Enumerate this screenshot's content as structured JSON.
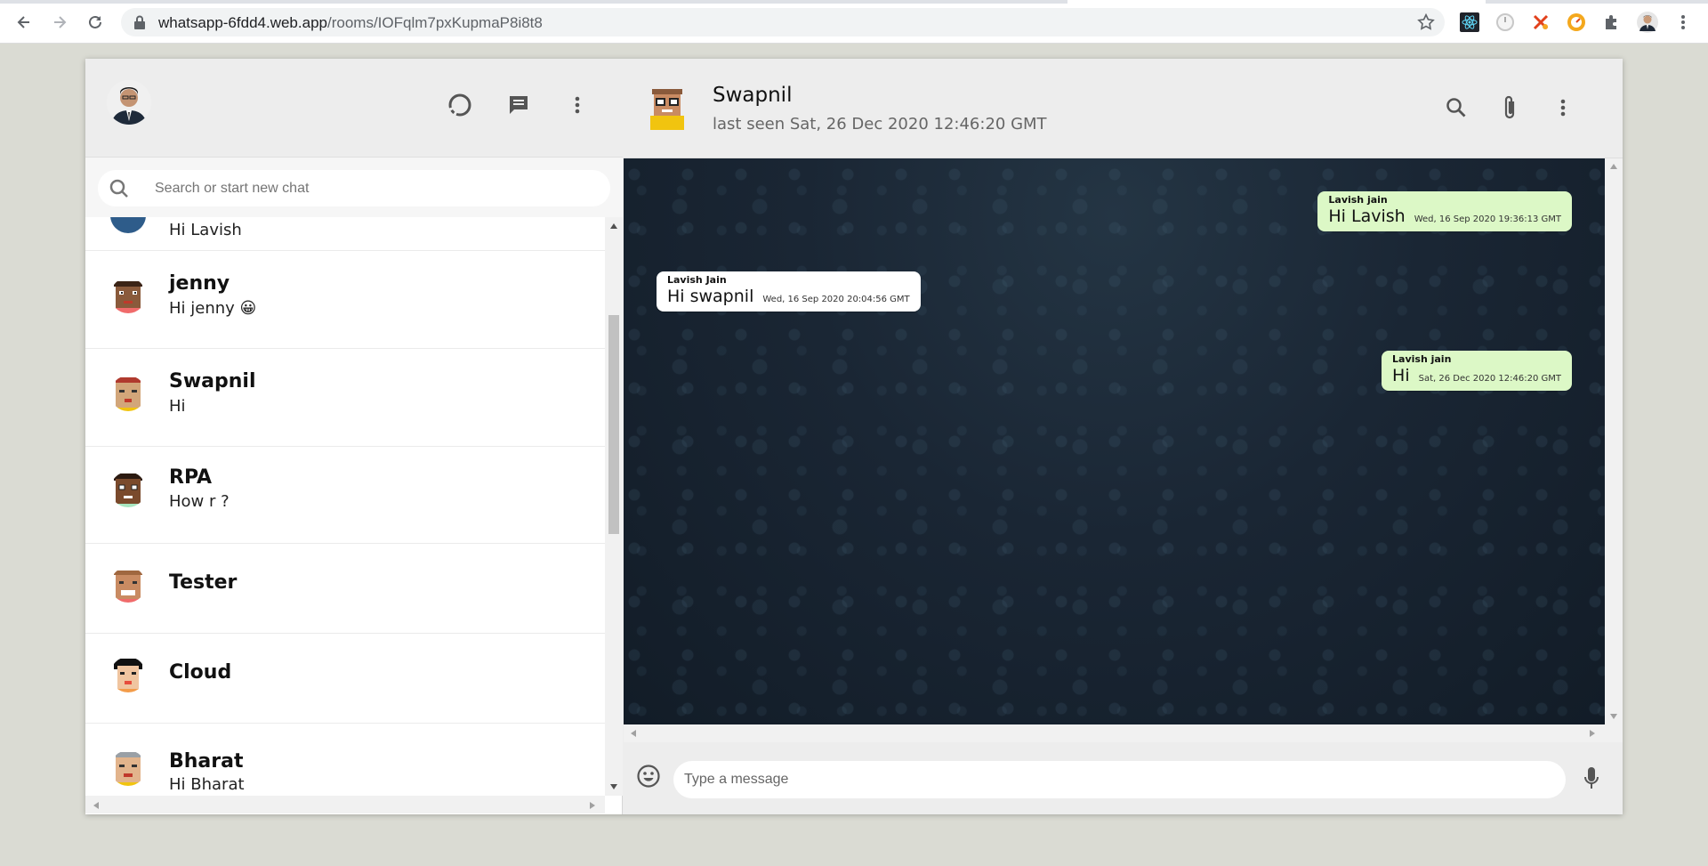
{
  "browser": {
    "url_host": "whatsapp-6fdd4.web.app",
    "url_path": "/rooms/IOFqlm7pxKupmaP8i8t8"
  },
  "sidebar": {
    "search_placeholder": "Search or start new chat",
    "chats": [
      {
        "name": "",
        "last": "Hi Lavish"
      },
      {
        "name": "jenny",
        "last": "Hi jenny 😀"
      },
      {
        "name": "Swapnil",
        "last": "Hi"
      },
      {
        "name": "RPA",
        "last": "How r ?"
      },
      {
        "name": "Tester",
        "last": ""
      },
      {
        "name": "Cloud",
        "last": ""
      },
      {
        "name": "Bharat",
        "last": "Hi Bharat"
      }
    ]
  },
  "chat": {
    "title": "Swapnil",
    "last_seen": "last seen Sat, 26 Dec 2020 12:46:20 GMT",
    "messages": [
      {
        "author": "Lavish jain",
        "text": "Hi Lavish",
        "time": "Wed, 16 Sep 2020 19:36:13 GMT",
        "type": "sent"
      },
      {
        "author": "Lavish Jain",
        "text": "Hi swapnil",
        "time": "Wed, 16 Sep 2020 20:04:56 GMT",
        "type": "received"
      },
      {
        "author": "Lavish jain",
        "text": "Hi",
        "time": "Sat, 26 Dec 2020 12:46:20 GMT",
        "type": "sent"
      }
    ],
    "input_placeholder": "Type a message"
  },
  "colors": {
    "sent_bubble": "#dcf8c6",
    "received_bubble": "#ffffff",
    "header_bg": "#ededed",
    "chat_bg": "#1a2634"
  }
}
